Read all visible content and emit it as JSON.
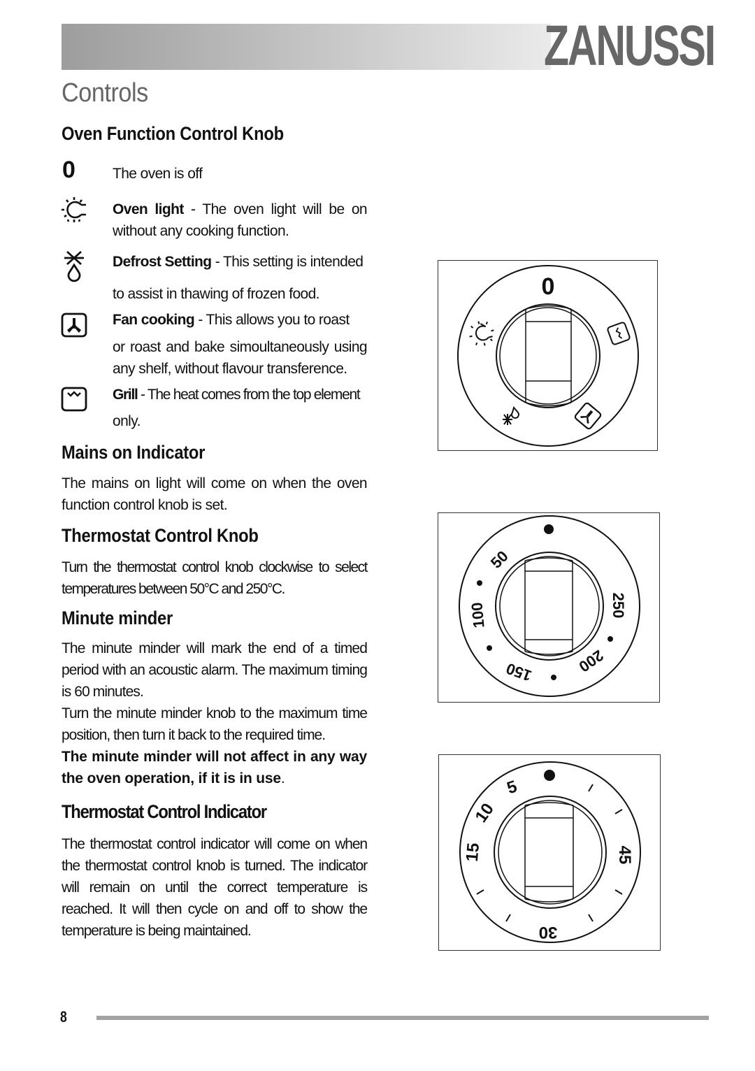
{
  "header": {
    "brand": "ZANUSSI",
    "brand_color": "#676767"
  },
  "page_title": "Controls",
  "sections": {
    "oven_function": {
      "heading": "Oven Function Control Knob",
      "items": [
        {
          "symbol": "0",
          "icon": "zero-symbol",
          "text": "The oven is off"
        },
        {
          "icon": "oven-light-icon",
          "bold": "Oven light",
          "text": " - The oven light will be on without any cooking function."
        },
        {
          "icon": "defrost-icon",
          "bold": "Defrost Setting",
          "text": " - This setting is intended",
          "text2": "to assist in thawing of frozen food."
        },
        {
          "icon": "fan-cooking-icon",
          "bold": "Fan cooking",
          "text": " - This allows you to roast",
          "text2": "or roast and bake simoultaneously using any shelf, without flavour transference."
        },
        {
          "icon": "grill-icon",
          "bold": "Grill",
          "text": " - The heat comes from the top element",
          "text2": "only."
        }
      ]
    },
    "mains_on": {
      "heading": "Mains on Indicator",
      "text": "The mains on light will come on when the oven function control knob is set."
    },
    "thermostat_knob": {
      "heading": "Thermostat Control Knob",
      "text": "Turn the thermostat control knob clockwise to select temperatures between 50°C and 250°C."
    },
    "minute_minder": {
      "heading": "Minute minder",
      "text1": "The minute minder will mark the end of a timed period with an acoustic alarm. The maximum timing is 60 minutes.",
      "text2": "Turn the minute minder knob to the maximum time position, then turn it back to the required time.",
      "bold_note": "The minute minder will not affect in any way the oven operation, if it is in use",
      "bold_note_end": "."
    },
    "thermostat_indicator": {
      "heading": "Thermostat Control Indicator",
      "text": "The thermostat control indicator will come on when the thermostat control knob is turned. The indicator will remain on until the correct temperature is reached. It will then cycle on and off to show the temperature is being maintained."
    }
  },
  "diagrams": {
    "function_knob": {
      "top_label": "0",
      "symbols": [
        "oven-light",
        "grill",
        "fan-cooking",
        "defrost"
      ]
    },
    "thermostat_knob": {
      "labels": [
        "50",
        "100",
        "150",
        "200",
        "250"
      ]
    },
    "minute_minder_knob": {
      "labels": [
        "5",
        "10",
        "15",
        "30",
        "45"
      ]
    }
  },
  "footer": {
    "page_number": "8"
  }
}
